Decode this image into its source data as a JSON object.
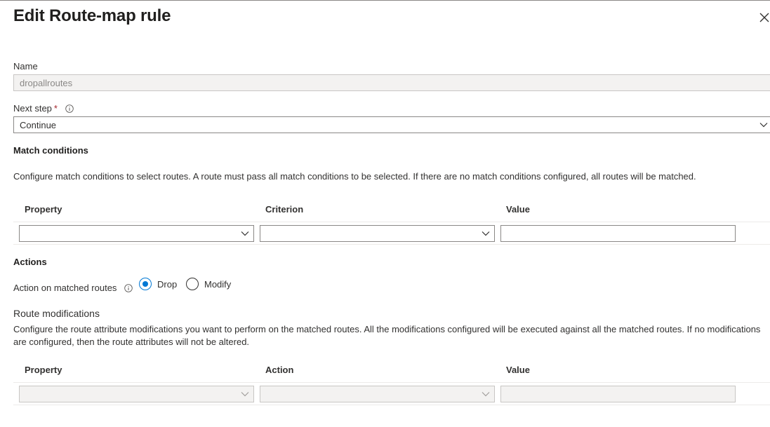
{
  "panel": {
    "title": "Edit Route-map rule",
    "close_icon": "close-icon"
  },
  "name_field": {
    "label": "Name",
    "value": "dropallroutes"
  },
  "next_step": {
    "label": "Next step",
    "required_mark": "*",
    "selected": "Continue"
  },
  "match_conditions": {
    "heading": "Match conditions",
    "description": "Configure match conditions to select routes. A route must pass all match conditions to be selected. If there are no match conditions configured, all routes will be matched.",
    "columns": [
      "Property",
      "Criterion",
      "Value"
    ],
    "row": {
      "property": "",
      "criterion": "",
      "value": ""
    }
  },
  "actions": {
    "heading": "Actions",
    "action_label": "Action on matched routes",
    "options": [
      "Drop",
      "Modify"
    ],
    "selected": "Drop"
  },
  "route_modifications": {
    "heading": "Route modifications",
    "description_line1": "Configure the route attribute modifications you want to perform on the matched routes. All the modifications configured will be executed against all the matched routes. If no modifications",
    "description_line2": "are configured, then the route attributes will not be altered.",
    "columns": [
      "Property",
      "Action",
      "Value"
    ],
    "row": {
      "property": "",
      "action": "",
      "value": ""
    }
  },
  "colors": {
    "accent": "#0078d4",
    "required": "#a4262c",
    "disabled_bg": "#f3f2f1"
  }
}
